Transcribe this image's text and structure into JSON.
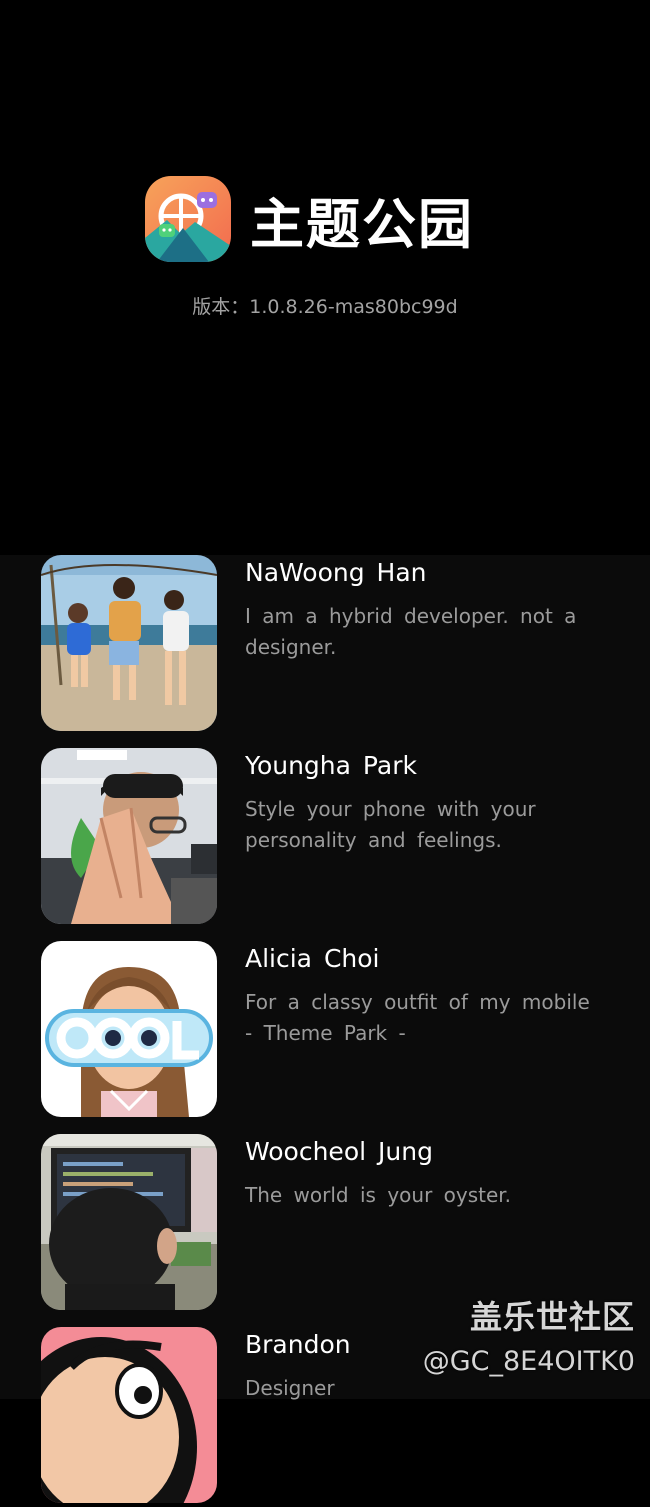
{
  "app": {
    "name": "主题公园",
    "version": "版本：1.0.8.26-mas80bc99d",
    "icon": "theme-park-logo-icon"
  },
  "team": [
    {
      "name": "NaWoong Han",
      "desc": "I am a hybrid developer. not a designer.",
      "avatar": "kids-photo"
    },
    {
      "name": "Youngha Park",
      "desc": "Style your phone with your personality and feelings.",
      "avatar": "office-photo"
    },
    {
      "name": "Alicia Choi",
      "desc": "For a classy outfit of my mobile - Theme Park -",
      "avatar": "cool-cartoon"
    },
    {
      "name": "Woocheol Jung",
      "desc": "The world is your oyster.",
      "avatar": "monitor-photo"
    },
    {
      "name": "Brandon",
      "desc": "Designer",
      "avatar": "cartoon-pink"
    }
  ],
  "watermark": {
    "title": "盖乐世社区",
    "handle": "@GC_8E4OITK0"
  }
}
